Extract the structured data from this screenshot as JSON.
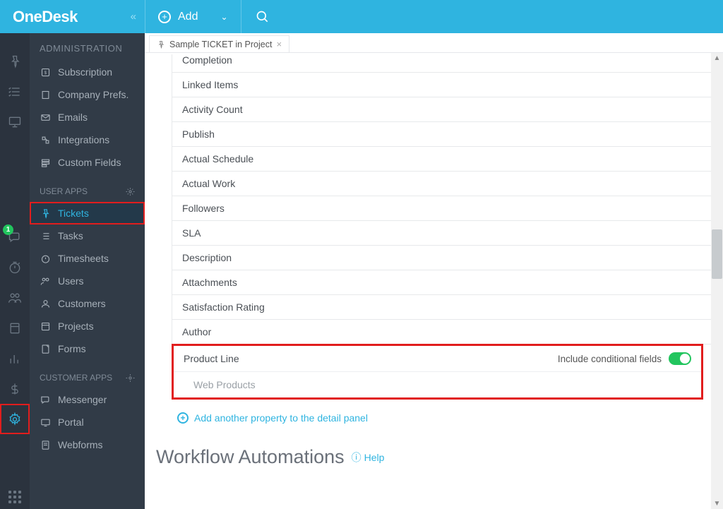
{
  "topbar": {
    "logo": "OneDesk",
    "add_label": "Add"
  },
  "rail": {
    "badge": "1"
  },
  "sidebar": {
    "section_admin": "ADMINISTRATION",
    "admin_items": [
      {
        "label": "Subscription"
      },
      {
        "label": "Company Prefs."
      },
      {
        "label": "Emails"
      },
      {
        "label": "Integrations"
      },
      {
        "label": "Custom Fields"
      }
    ],
    "section_userapps": "USER APPS",
    "userapps_items": [
      {
        "label": "Tickets",
        "active": true
      },
      {
        "label": "Tasks"
      },
      {
        "label": "Timesheets"
      },
      {
        "label": "Users"
      },
      {
        "label": "Customers"
      },
      {
        "label": "Projects"
      },
      {
        "label": "Forms"
      }
    ],
    "section_customerapps": "CUSTOMER APPS",
    "customerapps_items": [
      {
        "label": "Messenger"
      },
      {
        "label": "Portal"
      },
      {
        "label": "Webforms"
      }
    ]
  },
  "tab": {
    "label": "Sample TICKET in Project"
  },
  "properties": [
    "Completion",
    "Linked Items",
    "Activity Count",
    "Publish",
    "Actual Schedule",
    "Actual Work",
    "Followers",
    "SLA",
    "Description",
    "Attachments",
    "Satisfaction Rating",
    "Author"
  ],
  "highlight": {
    "title": "Product Line",
    "include_label": "Include conditional fields",
    "sub_item": "Web Products"
  },
  "add_property": "Add another property to the detail panel",
  "wf_title": "Workflow Automations",
  "wf_help": "Help"
}
